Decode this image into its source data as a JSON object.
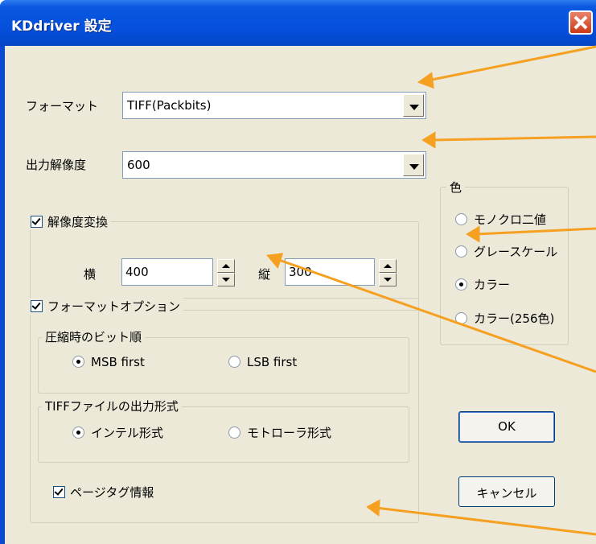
{
  "window": {
    "title": "KDdriver 設定"
  },
  "format": {
    "label": "フォーマット",
    "value": "TIFF(Packbits)"
  },
  "resolution": {
    "label": "出力解像度",
    "value": "600"
  },
  "convert": {
    "label": "解像度変換",
    "checked": true,
    "h_label": "横",
    "h_value": "400",
    "v_label": "縦",
    "v_value": "300"
  },
  "color": {
    "label": "色",
    "options": [
      "モノクロ二値",
      "グレースケール",
      "カラー",
      "カラー(256色)"
    ],
    "selected": "カラー"
  },
  "format_options": {
    "label": "フォーマットオプション",
    "checked": true,
    "bitorder": {
      "label": "圧縮時のビット順",
      "options": [
        "MSB first",
        "LSB first"
      ],
      "selected": "MSB first"
    },
    "tiff_output": {
      "label": "TIFFファイルの出力形式",
      "options": [
        "インテル形式",
        "モトローラ形式"
      ],
      "selected": "インテル形式"
    },
    "page_tag": {
      "label": "ページタグ情報",
      "checked": true
    }
  },
  "buttons": {
    "ok": "OK",
    "cancel": "キャンセル"
  },
  "colors": {
    "titlebar": "#0550dc",
    "dialog_bg": "#ece9d8",
    "annotation_arrow": "#f5a020"
  }
}
